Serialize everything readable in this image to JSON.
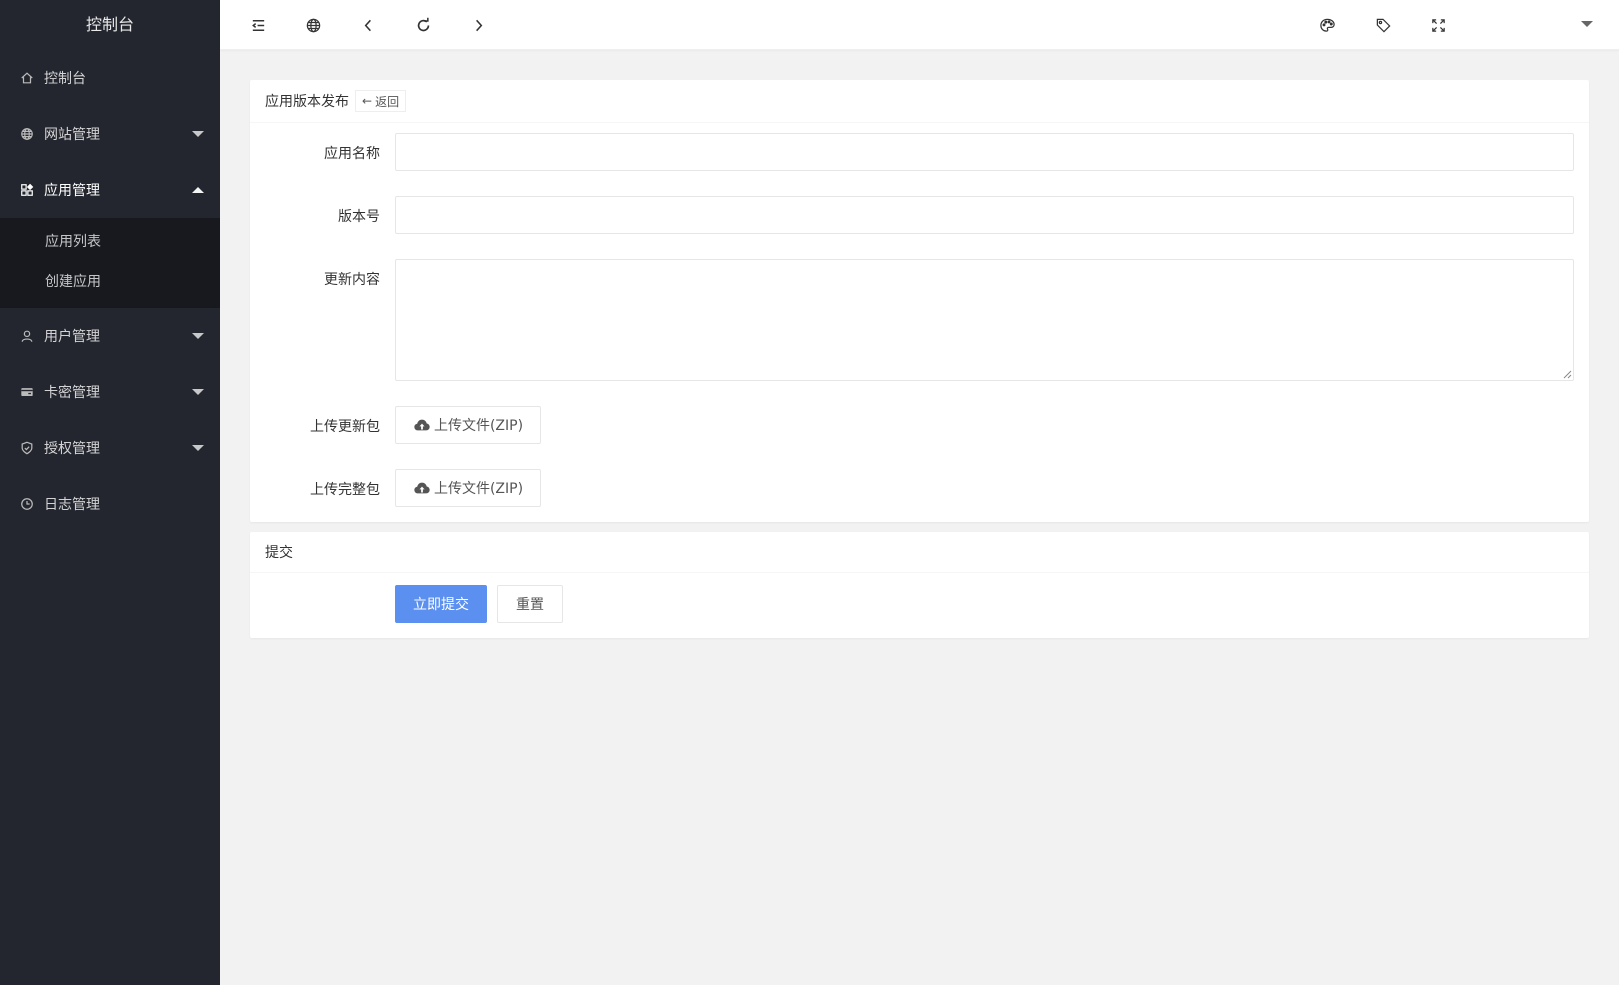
{
  "sidebar": {
    "logo": "控制台",
    "items": [
      {
        "label": "控制台",
        "icon": "home-icon"
      },
      {
        "label": "网站管理",
        "icon": "globe-icon"
      },
      {
        "label": "应用管理",
        "icon": "apps-icon"
      },
      {
        "label": "用户管理",
        "icon": "user-icon"
      },
      {
        "label": "卡密管理",
        "icon": "card-icon"
      },
      {
        "label": "授权管理",
        "icon": "shield-icon"
      },
      {
        "label": "日志管理",
        "icon": "clock-icon"
      }
    ],
    "submenu": [
      {
        "label": "应用列表"
      },
      {
        "label": "创建应用"
      }
    ]
  },
  "header": {
    "icons": [
      "menu-fold-icon",
      "globe-icon",
      "chevron-left-icon",
      "refresh-icon",
      "chevron-right-icon",
      "palette-icon",
      "tag-icon",
      "fullscreen-icon",
      "chevron-down-icon"
    ]
  },
  "form_card": {
    "title": "应用版本发布",
    "back_label": "返回",
    "fields": {
      "app_name_label": "应用名称",
      "app_name_value": "",
      "version_label": "版本号",
      "version_value": "",
      "content_label": "更新内容",
      "content_value": "",
      "update_pkg_label": "上传更新包",
      "update_pkg_button": "上传文件(ZIP)",
      "full_pkg_label": "上传完整包",
      "full_pkg_button": "上传文件(ZIP)"
    }
  },
  "submit_card": {
    "title": "提交",
    "submit_label": "立即提交",
    "reset_label": "重置"
  },
  "colors": {
    "sidebar_bg": "#23262e",
    "submenu_bg": "#17191f",
    "primary": "#5b8ff0",
    "page_bg": "#f2f2f2"
  }
}
